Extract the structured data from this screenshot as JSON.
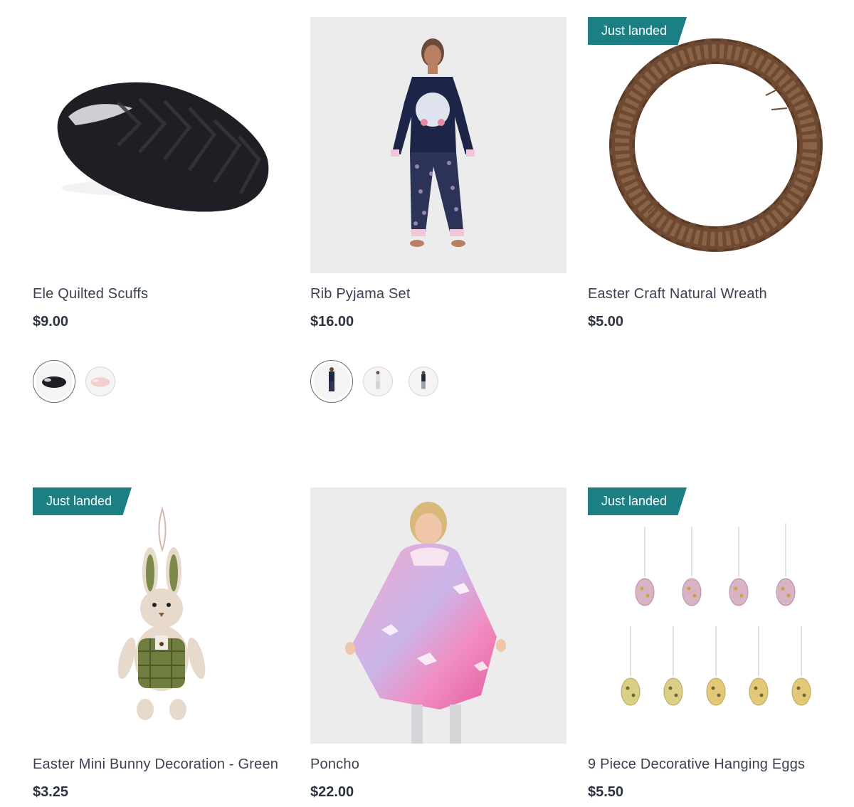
{
  "products": [
    {
      "title": "Ele Quilted Scuffs",
      "price": "$9.00"
    },
    {
      "title": "Rib Pyjama Set",
      "price": "$16.00"
    },
    {
      "title": "Easter Craft Natural Wreath",
      "price": "$5.00",
      "badge": "Just landed"
    },
    {
      "title": "Easter Mini Bunny Decoration - Green",
      "price": "$3.25",
      "badge": "Just landed"
    },
    {
      "title": "Poncho",
      "price": "$22.00"
    },
    {
      "title": "9 Piece Decorative Hanging Eggs",
      "price": "$5.50",
      "badge": "Just landed"
    }
  ],
  "colors": {
    "badge": "#1c7f83",
    "text": "#3a4150",
    "price": "#2c3340",
    "image_bg": "#ececec"
  }
}
